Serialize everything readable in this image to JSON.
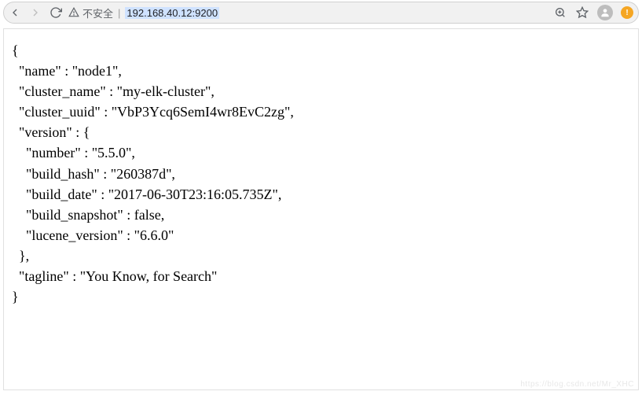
{
  "toolbar": {
    "security_label": "不安全",
    "url": "192.168.40.12:9200",
    "badge": "!"
  },
  "response": {
    "name": "node1",
    "cluster_name": "my-elk-cluster",
    "cluster_uuid": "VbP3Ycq6SemI4wr8EvC2zg",
    "version": {
      "number": "5.5.0",
      "build_hash": "260387d",
      "build_date": "2017-06-30T23:16:05.735Z",
      "build_snapshot": false,
      "lucene_version": "6.6.0"
    },
    "tagline": "You Know, for Search"
  },
  "labels": {
    "name": "name",
    "cluster_name": "cluster_name",
    "cluster_uuid": "cluster_uuid",
    "version": "version",
    "number": "number",
    "build_hash": "build_hash",
    "build_date": "build_date",
    "build_snapshot": "build_snapshot",
    "lucene_version": "lucene_version",
    "tagline": "tagline"
  },
  "watermark": "https://blog.csdn.net/Mr_XHC"
}
